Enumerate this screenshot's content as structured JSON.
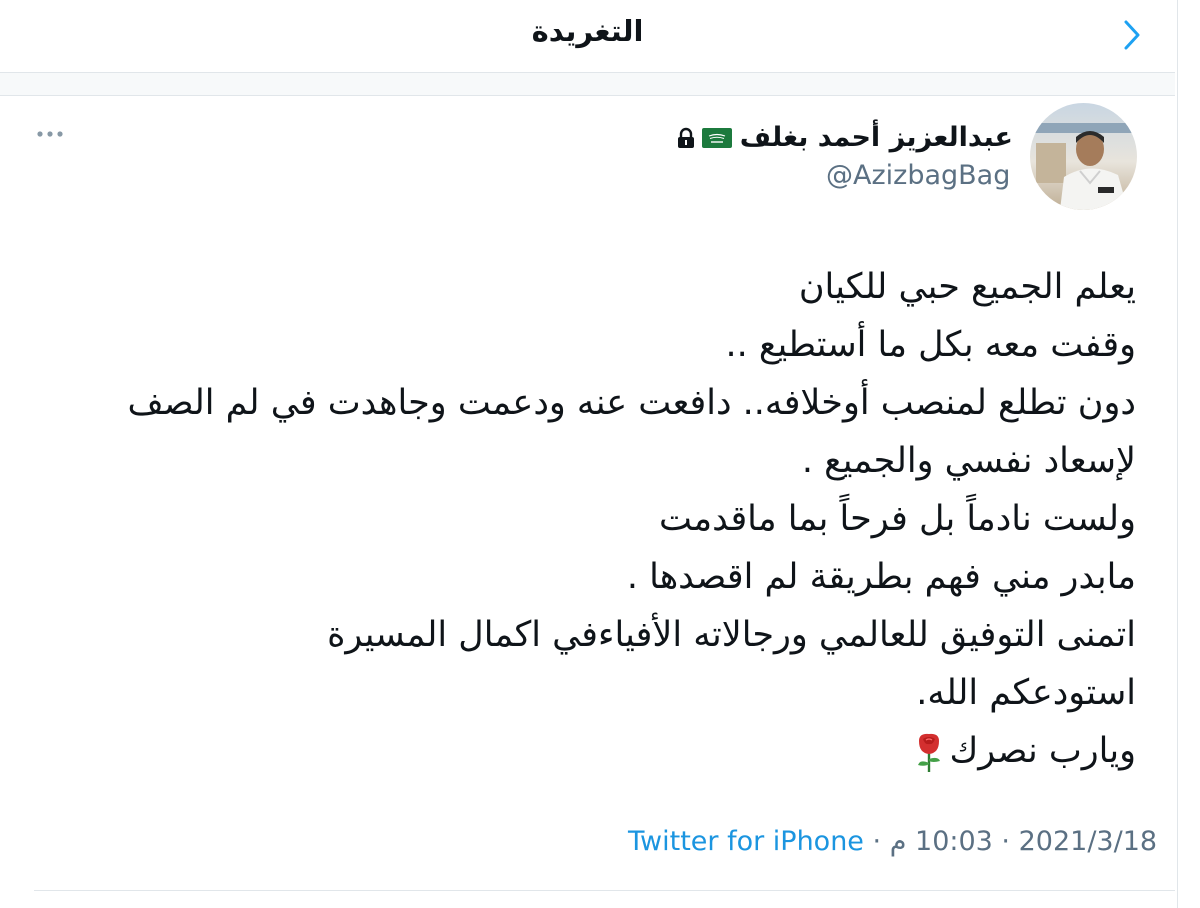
{
  "header": {
    "title": "التغريدة"
  },
  "author": {
    "display_name": "عبدالعزيز أحمد بغلف",
    "handle": "@AzizbagBag",
    "badges": [
      "flag-icon",
      "lock-icon"
    ]
  },
  "tweet": {
    "lines": [
      "يعلم الجميع حبي للكيان",
      "وقفت معه بكل ما أستطيع ..",
      "دون تطلع لمنصب أوخلافه.. دافعت عنه ودعمت وجاهدت في لم الصف",
      "لإسعاد نفسي والجميع .",
      "ولست نادماً بل فرحاً بما ماقدمت",
      "مابدر مني فهم بطريقة لم اقصدها .",
      "اتمنى التوفيق للعالمي ورجالاته الأفياءفي اكمال المسيرة",
      "استودعكم الله.",
      "ويارب نصرك"
    ]
  },
  "meta": {
    "date": "2021/3/18",
    "separator": "·",
    "time": "10:03 م",
    "source": "Twitter for iPhone"
  },
  "colors": {
    "accent": "#1da1f2",
    "link": "#1b95e0",
    "secondary_text": "#5b7083",
    "divider": "#e1e6ea"
  }
}
